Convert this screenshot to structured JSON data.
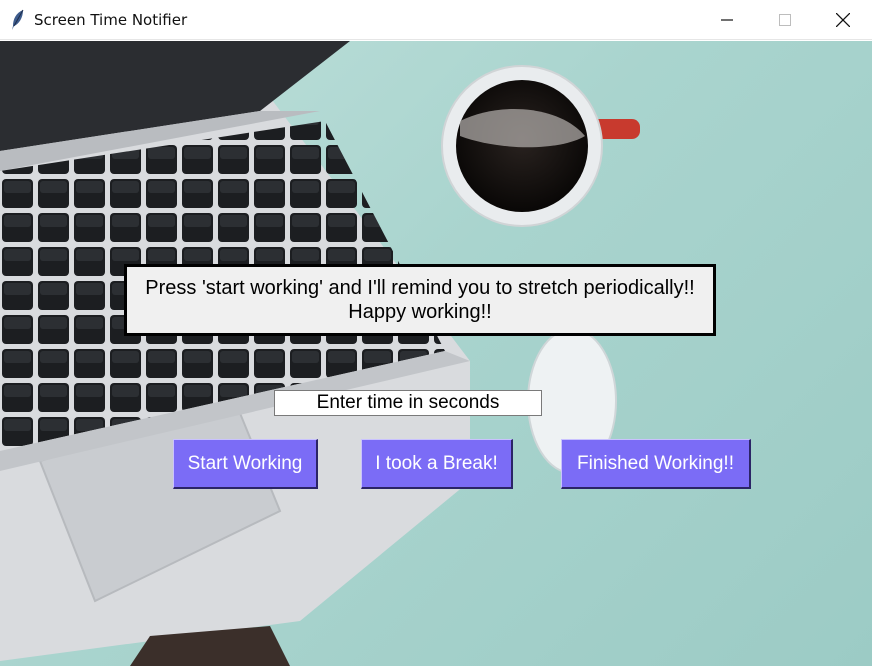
{
  "window": {
    "title": "Screen Time Notifier",
    "icons": {
      "app": "feather-icon",
      "minimize": "minimize-icon",
      "maximize": "maximize-icon",
      "close": "close-icon"
    }
  },
  "background": {
    "description_icons": [
      "laptop",
      "coffee-cup",
      "mouse",
      "notebook"
    ],
    "colors": {
      "backdrop": "#a9d4ce",
      "laptop_body": "#d5d7da",
      "keys": "#1d1f22",
      "coffee": "#0f0d0c",
      "mug_handle": "#c83a2e"
    }
  },
  "message": {
    "line1": "Press 'start working' and I'll remind you to stretch periodically!!",
    "line2": "Happy working!!"
  },
  "time_input": {
    "value": "Enter time in seconds"
  },
  "buttons": {
    "start": "Start Working",
    "break": "I took a Break!",
    "finish": "Finished Working!!"
  },
  "colors": {
    "button_bg": "#7b6cf6",
    "button_text": "#ffffff",
    "message_bg": "#f0f0f0"
  }
}
